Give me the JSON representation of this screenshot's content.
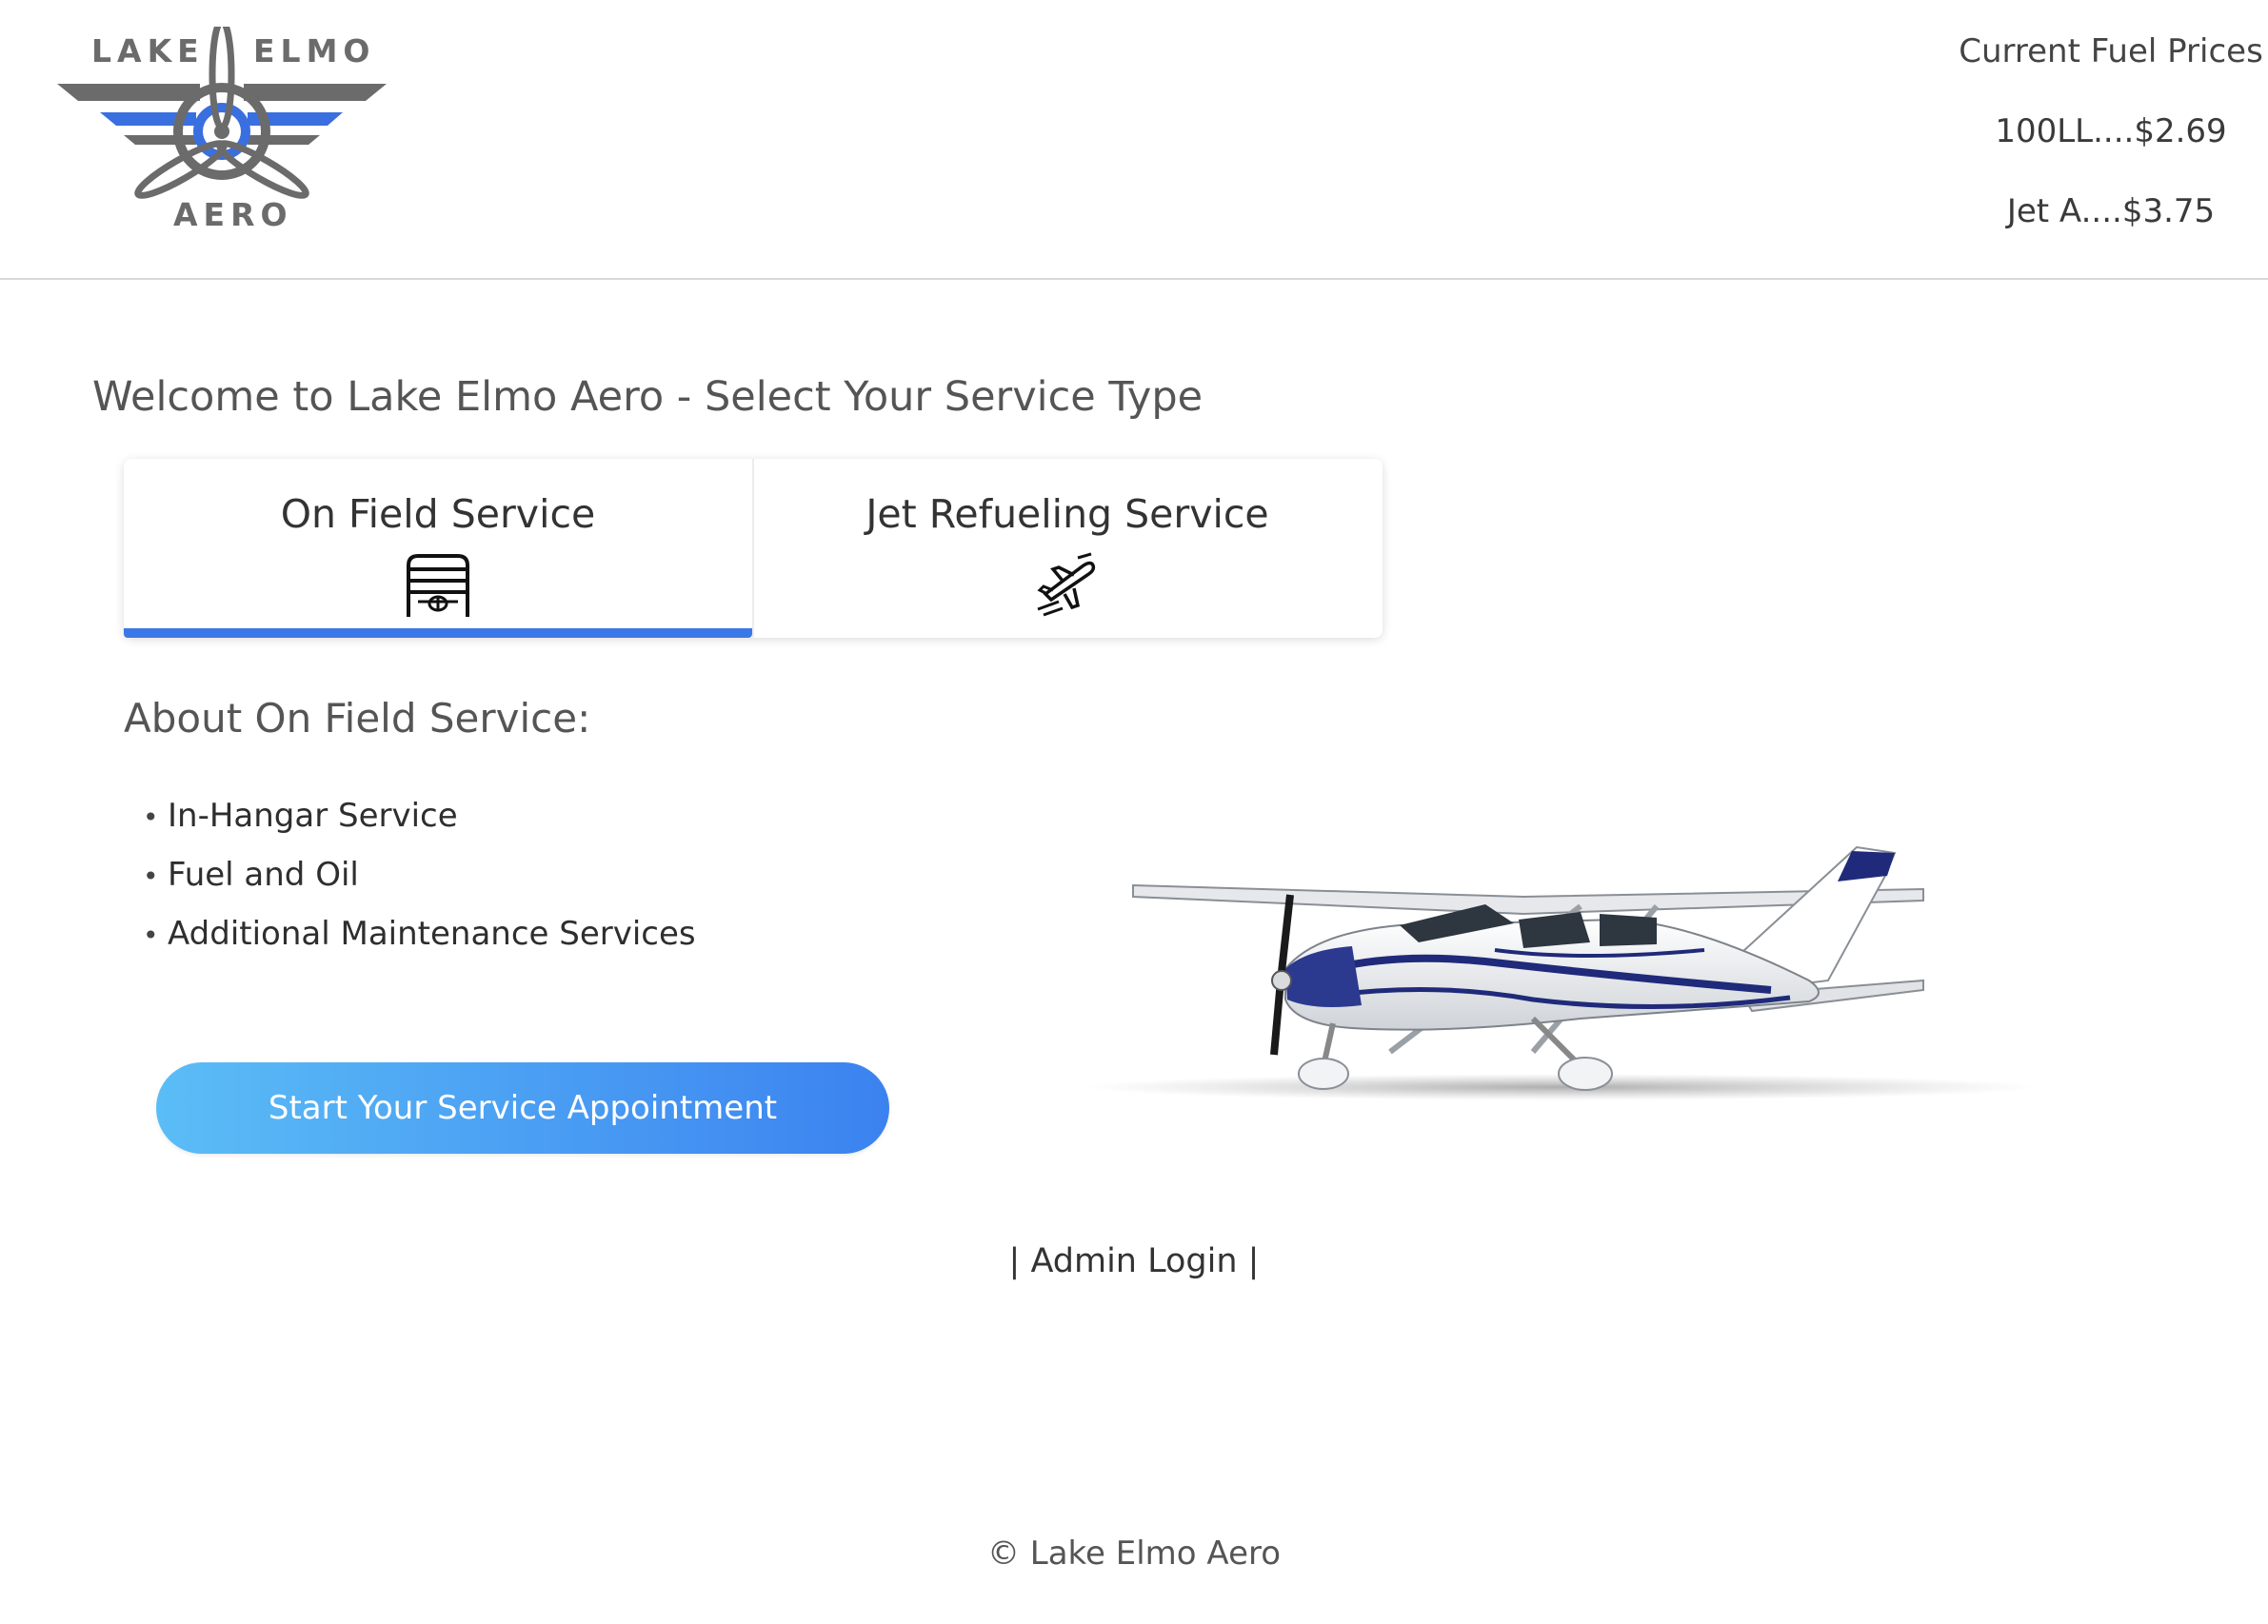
{
  "header": {
    "logo": {
      "word_left": "LAKE",
      "word_right": "ELMO",
      "word_bottom": "AERO"
    },
    "fuel_prices": {
      "title": "Current Fuel Prices",
      "items": [
        {
          "label": "100LL....$2.69"
        },
        {
          "label": "Jet A....$3.75"
        }
      ]
    }
  },
  "main": {
    "welcome": "Welcome to Lake Elmo Aero - Select Your Service Type",
    "tabs": [
      {
        "label": "On Field Service",
        "icon": "hangar-icon",
        "active": true
      },
      {
        "label": "Jet Refueling Service",
        "icon": "jet-icon",
        "active": false
      }
    ],
    "about": {
      "title": "About On Field Service:",
      "items": [
        "In-Hangar Service",
        "Fuel and Oil",
        "Additional Maintenance Services"
      ]
    },
    "cta_label": "Start Your Service Appointment"
  },
  "admin_login": "| Admin Login |",
  "footer": "© Lake Elmo Aero",
  "colors": {
    "accent": "#3b78e7",
    "cta_gradient_start": "#5bbdf6",
    "cta_gradient_end": "#3b82f0",
    "logo_gray": "#6b6b6b",
    "logo_blue": "#3a6fe0"
  }
}
